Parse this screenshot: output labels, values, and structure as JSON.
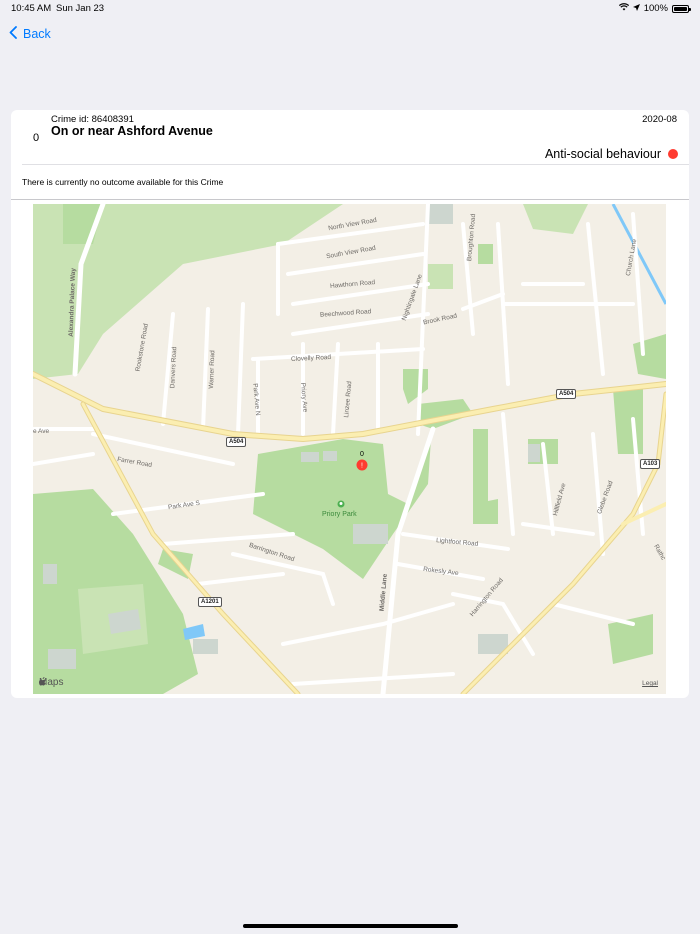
{
  "status": {
    "time": "10:45 AM",
    "date": "Sun Jan 23",
    "battery_text": "100%",
    "battery_level": 1.0
  },
  "nav": {
    "back_label": "Back"
  },
  "crime": {
    "index": "0",
    "id_label": "Crime id: 86408391",
    "date": "2020-08",
    "location": "On or near Ashford Avenue",
    "category": "Anti-social behaviour",
    "category_color": "#ff3b30",
    "outcome": "There is currently no outcome available for this Crime"
  },
  "map": {
    "pin_label": "0",
    "labels": {
      "north_view": "North View Road",
      "south_view": "South View Road",
      "hawthorn": "Hawthorn Road",
      "beechwood": "Beechwood Road",
      "clovelly": "Clovelly Road",
      "brook": "Brook Road",
      "nightingale": "Nightingale Lane",
      "broughton": "Broughton Road",
      "alexandra": "Alexandra Palace Way",
      "rookstone": "Rookstone Road",
      "danvers": "Danvers Road",
      "warner": "Warner Road",
      "park_ave_n": "Park Ave N",
      "priory_ave": "Priory Ave",
      "linzee": "Linzee Road",
      "farrer": "Farrer Road",
      "park_ave_s": "Park Ave S",
      "barrington": "Barrington Road",
      "lightfoot": "Lightfoot Road",
      "rokesly": "Rokesly Ave",
      "harrington": "Harrington Road",
      "middle_lane": "Middle Lane",
      "hillfield": "Hillfield Ave",
      "glebe": "Glebe Road",
      "church": "Church Lane",
      "ave_left": "e Ave",
      "rathc": "Rathc"
    },
    "badges": {
      "a504_left": "A504",
      "a504_right": "A504",
      "a103": "A103",
      "a1201": "A1201"
    },
    "park": "Priory Park",
    "logo": "Maps",
    "legal": "Legal"
  }
}
